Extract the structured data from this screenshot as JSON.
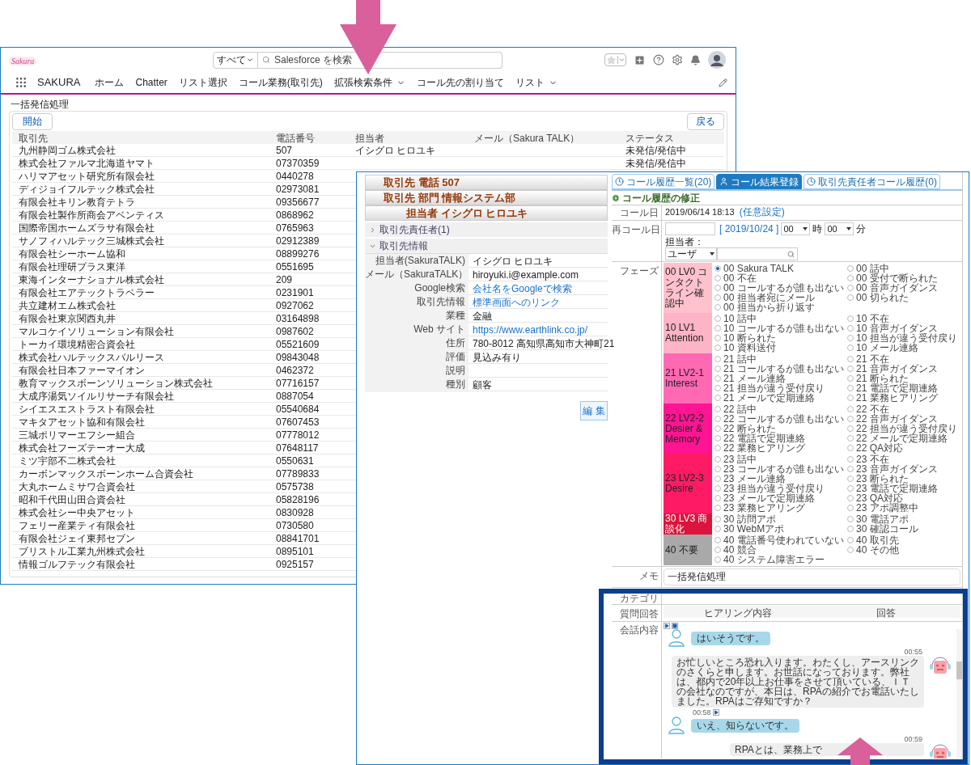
{
  "header": {
    "logo": "Sakura",
    "search_scope": "すべて",
    "search_placeholder": "Salesforce を検索"
  },
  "nav": {
    "app_name": "SAKURA",
    "items": [
      {
        "label": "ホーム",
        "has_menu": false
      },
      {
        "label": "Chatter",
        "has_menu": false
      },
      {
        "label": "リスト選択",
        "has_menu": false
      },
      {
        "label": "コール業務(取引先)",
        "has_menu": false
      },
      {
        "label": "拡張検索条件",
        "has_menu": true
      },
      {
        "label": "コール先の割り当て",
        "has_menu": false
      },
      {
        "label": "リスト",
        "has_menu": true
      }
    ]
  },
  "page_title": "一括発信処理",
  "toolbar": {
    "start_button": "開始",
    "back_button": "戻る"
  },
  "table": {
    "columns": [
      "取引先",
      "電話番号",
      "担当者",
      "メール（Sakura TALK）",
      "ステータス"
    ],
    "rows": [
      {
        "account": "九州静岡ゴム株式会社",
        "phone": "507",
        "owner": "イシグロ ヒロユキ",
        "status": "未発信/発信中"
      },
      {
        "account": "株式会社ファルマ北海道ヤマト",
        "phone": "07370359",
        "status": "未発信/発信中"
      },
      {
        "account": "ハリマアセット研究所有限会社",
        "phone": "0440278"
      },
      {
        "account": "ディジョイフルテック株式会社",
        "phone": "02973081"
      },
      {
        "account": "有限会社キリン教育テトラ",
        "phone": "09356677"
      },
      {
        "account": "有限会社製作所商会アベンティス",
        "phone": "0868962"
      },
      {
        "account": "国際帝国ホームズラサ有限会社",
        "phone": "0765963"
      },
      {
        "account": "サノフィハルテック三城株式会社",
        "phone": "02912389"
      },
      {
        "account": "有限会社シーホーム協和",
        "phone": "08899276"
      },
      {
        "account": "有限会社理研プラス東洋",
        "phone": "0551695"
      },
      {
        "account": "東海インターナショナル株式会社",
        "phone": "209"
      },
      {
        "account": "有限会社エアテックトラベラー",
        "phone": "0231901"
      },
      {
        "account": "共立建材エム株式会社",
        "phone": "0927062"
      },
      {
        "account": "有限会社東京関西丸井",
        "phone": "03164898"
      },
      {
        "account": "マルコケイソリューション有限会社",
        "phone": "0987602"
      },
      {
        "account": "トーカイ環境精密合資会社",
        "phone": "05521609"
      },
      {
        "account": "株式会社ハルテックスバルリース",
        "phone": "09843048"
      },
      {
        "account": "有限会社日本ファーマイオン",
        "phone": "0462372"
      },
      {
        "account": "教育マックスボーンソリューション株式会社",
        "phone": "07716157"
      },
      {
        "account": "大成序湯気ソイルリサーチ有限会社",
        "phone": "0887054"
      },
      {
        "account": "シイエスエストラスト有限会社",
        "phone": "05540684"
      },
      {
        "account": "マキタアセット協和有限会社",
        "phone": "07607453"
      },
      {
        "account": "三城ポリマーエフシー組合",
        "phone": "07778012"
      },
      {
        "account": "株式会社フーズテーオー大成",
        "phone": "07648117"
      },
      {
        "account": "ミツ宇部不二株式会社",
        "phone": "0550631"
      },
      {
        "account": "カーボンマックスボーンホーム合資会社",
        "phone": "07789833"
      },
      {
        "account": "大丸ホームミサワ合資会社",
        "phone": "0575738"
      },
      {
        "account": "昭和千代田山田合資会社",
        "phone": "05828196"
      },
      {
        "account": "株式会社シー中央アセット",
        "phone": "0830928"
      },
      {
        "account": "フェリー産業ティ有限会社",
        "phone": "0730580"
      },
      {
        "account": "有限会社ジェイ東邦セブン",
        "phone": "08841701"
      },
      {
        "account": "ブリストル工業九州株式会社",
        "phone": "0895101"
      },
      {
        "account": "情報ゴルフテック有限会社",
        "phone": "0925157"
      }
    ]
  },
  "popup": {
    "header_lines": [
      {
        "text": "取引先 電話 507",
        "kind": "account"
      },
      {
        "text": "取引先 部門 情報システム部",
        "kind": "account"
      },
      {
        "text": "担当者 イシグロ ヒロユキ",
        "kind": "contact"
      }
    ],
    "sections": [
      {
        "label": "取引先責任者(1)",
        "expanded": false
      },
      {
        "label": "取引先情報",
        "expanded": true
      }
    ],
    "fields": [
      {
        "label": "担当者(SakuraTALK)",
        "value": "イシグロ ヒロユキ",
        "link": false
      },
      {
        "label": "メール（SakuraTALK）",
        "value": "hiroyuki.i@example.com",
        "link": false
      },
      {
        "label": "Google検索",
        "value": "会社名をGoogleで検索",
        "link": true
      },
      {
        "label": "取引先情報",
        "value": "標準画面へのリンク",
        "link": true
      },
      {
        "label": "業種",
        "value": "金融",
        "link": false
      },
      {
        "label": "Web サイト",
        "value": "https://www.earthlink.co.jp/",
        "link": true
      },
      {
        "label": "住所",
        "value": "780-8012 高知県高知市大神町21",
        "link": false
      },
      {
        "label": "評価",
        "value": "見込み有り",
        "link": false
      },
      {
        "label": "説明"
      },
      {
        "label": "種別",
        "value": "顧客",
        "link": false
      }
    ],
    "edit_button": "編 集",
    "tabs": [
      {
        "label": "コール履歴一覧(20)",
        "selected": false
      },
      {
        "label": "コール結果登録",
        "selected": true
      },
      {
        "label": "取引先責任者コール履歴(0)",
        "selected": false
      }
    ],
    "form": {
      "title": "コール履歴の修正",
      "call_date_label": "コール日",
      "call_date": "2019/06/14 18:13",
      "call_date_link": "(任意設定)",
      "recall_label": "再コール日",
      "recall_date": "[ 2019/10/24 ]",
      "hour": "00",
      "hour_unit": "時",
      "minute": "00",
      "minute_unit": "分",
      "owner_label": "担当者：",
      "owner_type": "ユーザ",
      "phase_label": "フェーズ",
      "phases": [
        {
          "label": "00 LV0 コンタクトライン確認中",
          "color": "#ffc1cc",
          "left": [
            {
              "label": "00 Sakura TALK",
              "selected": true
            },
            {
              "label": "00 不在",
              "selected": false
            },
            {
              "label": "00 コールするが誰も出ない",
              "selected": false
            },
            {
              "label": "00 担当者宛にメール",
              "selected": false
            },
            {
              "label": "00 担当から折り返す",
              "selected": false
            }
          ],
          "right": [
            {
              "label": "00 話中",
              "selected": false
            },
            {
              "label": "00 受付で断られた",
              "selected": false
            },
            {
              "label": "00 音声ガイダンス",
              "selected": false
            },
            {
              "label": "00 切られた",
              "selected": false
            }
          ]
        },
        {
          "label": "10 LV1 Attention",
          "color": "#ffb3c6",
          "left": [
            {
              "label": "10 話中",
              "selected": false
            },
            {
              "label": "10 コールするが誰も出ない",
              "selected": false
            },
            {
              "label": "10 断られた",
              "selected": false
            },
            {
              "label": "10 資料送付",
              "selected": false
            }
          ],
          "right": [
            {
              "label": "10 不在",
              "selected": false
            },
            {
              "label": "10 音声ガイダンス",
              "selected": false
            },
            {
              "label": "10 担当が違う受付戻り",
              "selected": false
            },
            {
              "label": "10 メール連絡",
              "selected": false
            }
          ]
        },
        {
          "label": "21 LV2-1 Interest",
          "color": "#ff69b4",
          "left": [
            {
              "label": "21 話中",
              "selected": false
            },
            {
              "label": "21 コールするが誰も出ない",
              "selected": false
            },
            {
              "label": "21 メール連絡",
              "selected": false
            },
            {
              "label": "21 担当が違う受付戻り",
              "selected": false
            },
            {
              "label": "21 メールで定期連絡",
              "selected": false
            }
          ],
          "right": [
            {
              "label": "21 不在",
              "selected": false
            },
            {
              "label": "21 音声ガイダンス",
              "selected": false
            },
            {
              "label": "21 断られた",
              "selected": false
            },
            {
              "label": "21 電話で定期連絡",
              "selected": false
            },
            {
              "label": "21 業務ヒアリング",
              "selected": false
            }
          ]
        },
        {
          "label": "22 LV2-2 Desier & Memory",
          "color": "#ff1493",
          "left": [
            {
              "label": "22 話中",
              "selected": false
            },
            {
              "label": "22 コールするが誰も出ない",
              "selected": false
            },
            {
              "label": "22 断られた",
              "selected": false
            },
            {
              "label": "22 電話で定期連絡",
              "selected": false
            },
            {
              "label": "22 業務ヒアリング",
              "selected": false
            }
          ],
          "right": [
            {
              "label": "22 不在",
              "selected": false
            },
            {
              "label": "22 音声ガイダンス",
              "selected": false
            },
            {
              "label": "22 担当が違う受付戻り",
              "selected": false
            },
            {
              "label": "22 メールで定期連絡",
              "selected": false
            },
            {
              "label": "22 QA対応",
              "selected": false
            }
          ]
        },
        {
          "label": "23 LV2-3 Desire",
          "color": "#ff1a66",
          "left": [
            {
              "label": "23 話中",
              "selected": false
            },
            {
              "label": "23 コールするが誰も出ない",
              "selected": false
            },
            {
              "label": "23 メール連絡",
              "selected": false
            },
            {
              "label": "23 担当が違う受付戻り",
              "selected": false
            },
            {
              "label": "23 メールで定期連絡",
              "selected": false
            },
            {
              "label": "23 業務ヒアリング",
              "selected": false
            }
          ],
          "right": [
            {
              "label": "23 不在",
              "selected": false
            },
            {
              "label": "23 音声ガイダンス",
              "selected": false
            },
            {
              "label": "23 断られた",
              "selected": false
            },
            {
              "label": "23 電話で定期連絡",
              "selected": false
            },
            {
              "label": "23 QA対応",
              "selected": false
            },
            {
              "label": "23 アポ調整中",
              "selected": false
            }
          ]
        },
        {
          "label": "30 LV3 商談化",
          "color": "#dc143c",
          "left": [
            {
              "label": "30 訪問アポ",
              "selected": false
            },
            {
              "label": "30 WebMアポ",
              "selected": false
            }
          ],
          "right": [
            {
              "label": "30 電話アポ",
              "selected": false
            },
            {
              "label": "30 確認コール",
              "selected": false
            }
          ]
        },
        {
          "label": "40 不要",
          "color": "#a9a9a9",
          "left": [
            {
              "label": "40 電話番号使われていない",
              "selected": false
            },
            {
              "label": "40 競合",
              "selected": false
            },
            {
              "label": "40 システム障害エラー",
              "selected": false
            }
          ],
          "right": [
            {
              "label": "40 取引先",
              "selected": false
            },
            {
              "label": "40 その他",
              "selected": false
            }
          ]
        }
      ],
      "memo_label": "メモ",
      "memo": "一括発信処理",
      "category_label": "カテゴリ",
      "qa_label": "質問回答",
      "qa_columns": [
        "ヒアリング内容",
        "回答"
      ],
      "conversation_label": "会話内容",
      "messages": [
        {
          "kind": "customer",
          "text": "はいそうです。"
        },
        {
          "kind": "agent",
          "time": "00:55",
          "text": "お忙しいところ恐れ入ります。わたくし、アースリンクのさくらと申します。お世話になっております。弊社は、都内で20年以上お仕事をさせて頂いている、ＩＴの会社なのですが、本日は、RPAの紹介でお電話いたしました。RPAはご存知ですか？"
        },
        {
          "kind": "customer",
          "time": "00:58",
          "text": "いえ、知らないです。"
        },
        {
          "kind": "agent",
          "time": "00:59",
          "text": "RPAとは、業務上で"
        }
      ]
    }
  }
}
